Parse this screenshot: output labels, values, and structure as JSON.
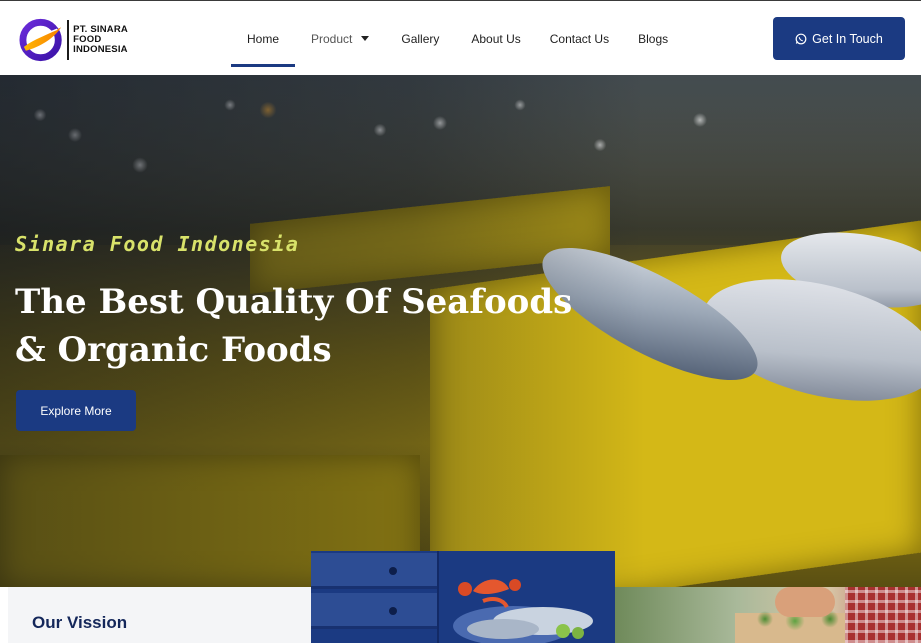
{
  "brand": {
    "name": "PT. SINARA FOOD INDONESIA",
    "name_lines": [
      "PT. SINARA",
      "FOOD",
      "INDONESIA"
    ],
    "colors": {
      "primary": "#1b3a82",
      "accent_text": "#d8e26a"
    }
  },
  "nav": {
    "items": [
      {
        "label": "Home",
        "active": true
      },
      {
        "label": "Product",
        "has_dropdown": true
      },
      {
        "label": "Gallery"
      },
      {
        "label": "About Us"
      },
      {
        "label": "Contact Us"
      },
      {
        "label": "Blogs"
      }
    ]
  },
  "header": {
    "cta_label": "Get In Touch",
    "cta_icon": "whatsapp-icon"
  },
  "hero": {
    "kicker": "Sinara Food Indonesia",
    "title_line1": "The Best Quality Of Seafoods",
    "title_line2": "& Organic Foods",
    "button_label": "Explore More"
  },
  "sections": {
    "vision_title": "Our Vission"
  }
}
